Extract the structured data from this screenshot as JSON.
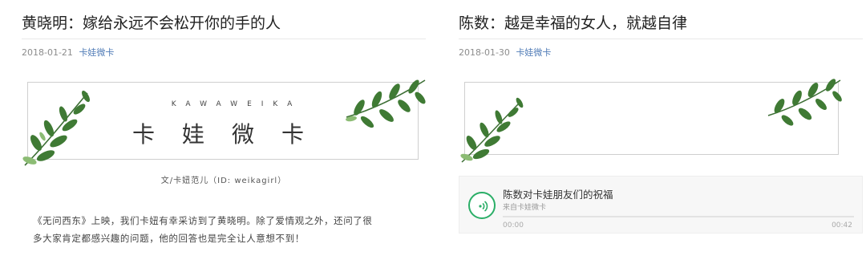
{
  "left_article": {
    "title": "黄晓明：嫁给永远不会松开你的手的人",
    "date": "2018-01-21",
    "author": "卡娃微卡",
    "banner": {
      "latin": "KAWAWEIKA",
      "chinese": "卡娃微卡"
    },
    "credit": "文/卡妞范儿（ID: weikagirl）",
    "body_line1": "《无问西东》上映，我们卡妞有幸采访到了黄晓明。除了爱情观之外，还问了很",
    "body_line2": "多大家肯定都感兴趣的问题，他的回答也是完全让人意想不到！"
  },
  "right_article": {
    "title": "陈数：越是幸福的女人，就越自律",
    "date": "2018-01-30",
    "author": "卡娃微卡",
    "audio": {
      "title": "陈数对卡娃朋友们的祝福",
      "source": "来自卡娃微卡",
      "current_time": "00:00",
      "duration": "00:42",
      "progress": 0
    }
  },
  "colors": {
    "accent_green": "#2aae67",
    "link_blue": "#4f7bb6",
    "leaf_dark": "#2f6b2a",
    "leaf_light": "#6fa85e"
  },
  "icons": [
    "leaf-branch-icon",
    "audio-play-icon"
  ]
}
